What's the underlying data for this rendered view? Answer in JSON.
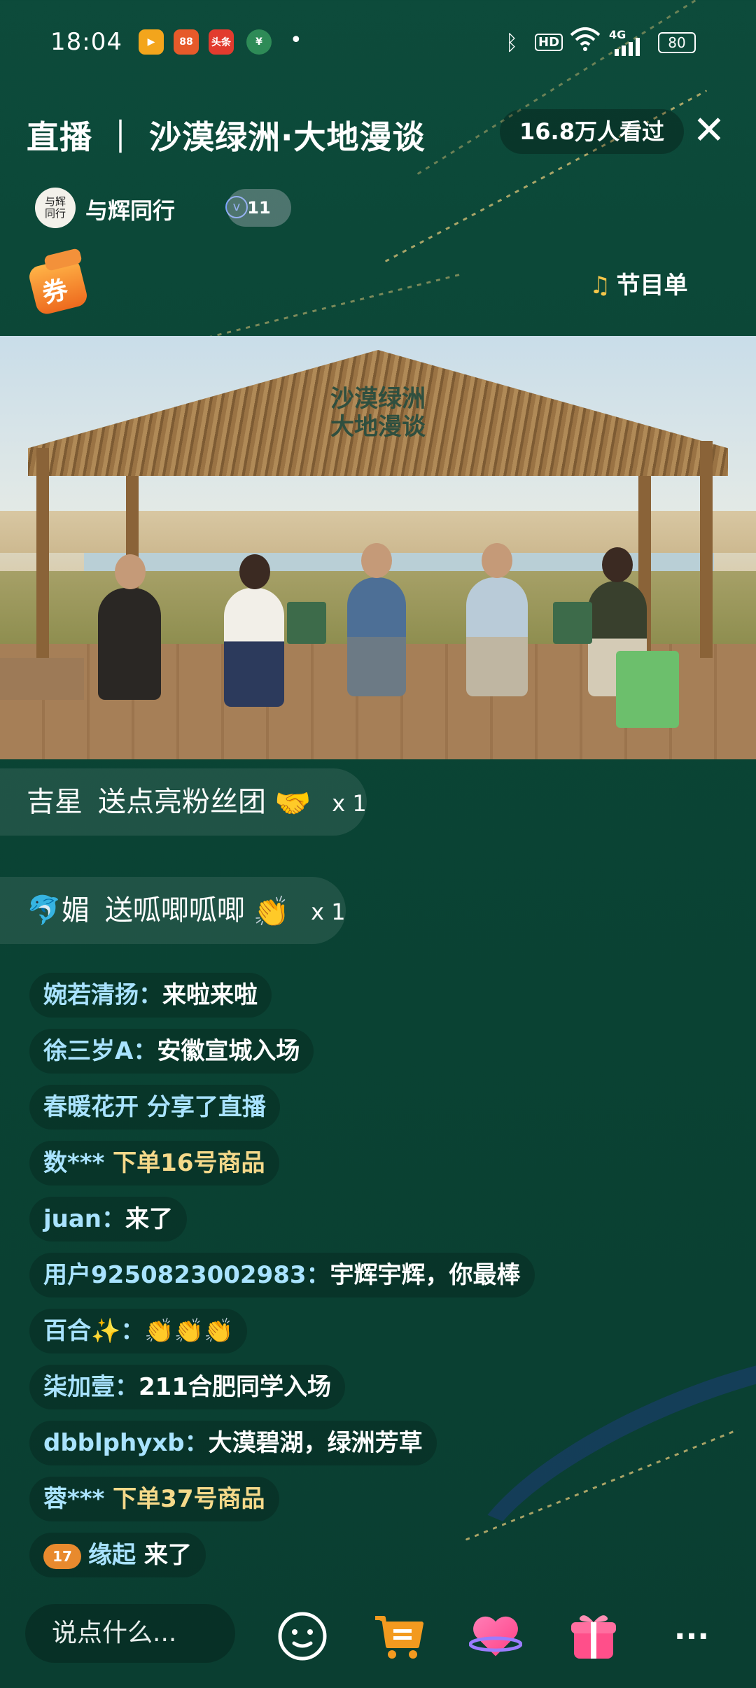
{
  "status_bar": {
    "time": "18:04",
    "apps": [
      {
        "icon": "video-app-icon",
        "text": "▶",
        "bg": "#f3a51c"
      },
      {
        "icon": "shopping-app-icon",
        "text": "88",
        "bg": "#e65a2a"
      },
      {
        "icon": "toutiao-app-icon",
        "text": "头条",
        "bg": "#e23b2e"
      },
      {
        "icon": "bank-app-icon",
        "text": "¥",
        "bg": "#2e8b57"
      }
    ],
    "dot": "•",
    "hd": "HD",
    "network": "4G",
    "battery": "80"
  },
  "header": {
    "title": "直播 ｜ 沙漠绿洲·大地漫谈",
    "viewers": "16.8万人看过",
    "close": "✕"
  },
  "host": {
    "avatar_text": "与辉\n同行",
    "name": "与辉同行",
    "verified": "v",
    "fan_level": "11"
  },
  "coupon": {
    "label": "券"
  },
  "playlist": {
    "label": "节目单"
  },
  "video": {
    "sign_text": "沙漠绿洲\n大地漫谈"
  },
  "gifts": [
    {
      "user": "吉星",
      "action": "送点亮粉丝团",
      "icon": "heart-hands-gift-icon",
      "emoji": "🤝",
      "count": "x 1"
    },
    {
      "user": "🐬媚",
      "action": "送呱唧呱唧",
      "icon": "clapping-gift-icon",
      "emoji": "👏",
      "count": "x 1"
    }
  ],
  "chat": [
    {
      "name": "婉若清扬：",
      "msg": "来啦来啦"
    },
    {
      "name": "徐三岁A：",
      "msg": "安徽宣城入场"
    },
    {
      "name": "春暖花开 分享了直播",
      "msg": ""
    },
    {
      "name": "数***",
      "msg": " 下单16号商品"
    },
    {
      "name": "juan：",
      "msg": "来了"
    },
    {
      "name": "用户9250823002983：",
      "msg": "宇辉宇辉，你最棒"
    },
    {
      "name": "百合✨：",
      "msg": "👏👏👏"
    },
    {
      "name": "柒加壹：",
      "msg": "211合肥同学入场"
    },
    {
      "name": "dbblphyxb：",
      "msg": "大漠碧湖，绿洲芳草"
    },
    {
      "name": "蓉***",
      "msg": " 下单37号商品"
    },
    {
      "name": "缘起",
      "msg": " 来了",
      "level": "17"
    }
  ],
  "bottom": {
    "input_placeholder": "说点什么...",
    "buttons": [
      "emoji-icon",
      "cart-icon",
      "like-heart-icon",
      "gift-box-icon",
      "more-icon"
    ],
    "more": "···"
  },
  "colors": {
    "background": "#0b4535",
    "chat_name": "#a9e3ff",
    "accent_orange": "#f08a2a"
  }
}
